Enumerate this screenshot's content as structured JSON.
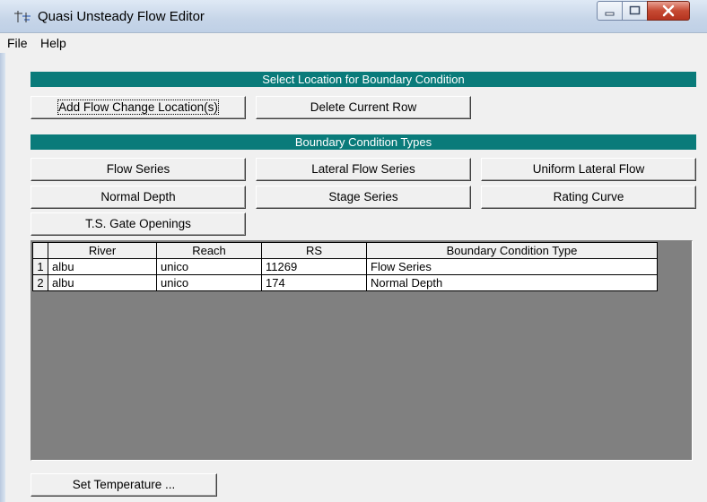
{
  "window": {
    "title": "Quasi Unsteady Flow Editor"
  },
  "menu": {
    "file": "File",
    "help": "Help"
  },
  "location_section": {
    "header": "Select Location for Boundary Condition",
    "add_button": "Add Flow Change Location(s)",
    "delete_button": "Delete Current Row"
  },
  "bc_types": {
    "header": "Boundary Condition Types",
    "flow_series": "Flow Series",
    "lateral_flow_series": "Lateral Flow Series",
    "uniform_lateral_flow": "Uniform Lateral Flow",
    "normal_depth": "Normal Depth",
    "stage_series": "Stage Series",
    "rating_curve": "Rating Curve",
    "ts_gate_openings": "T.S. Gate Openings"
  },
  "table": {
    "columns": [
      "",
      "River",
      "Reach",
      "RS",
      "Boundary Condition Type"
    ],
    "rows": [
      {
        "num": "1",
        "river": "albu",
        "reach": "unico",
        "rs": "11269",
        "type": "Flow Series"
      },
      {
        "num": "2",
        "river": "albu",
        "reach": "unico",
        "rs": "174",
        "type": "Normal Depth"
      }
    ]
  },
  "footer": {
    "set_temperature": "Set Temperature ..."
  },
  "colors": {
    "section_header": "#0a7b7a",
    "grid_background": "#808080",
    "close_button": "#c64a33"
  }
}
